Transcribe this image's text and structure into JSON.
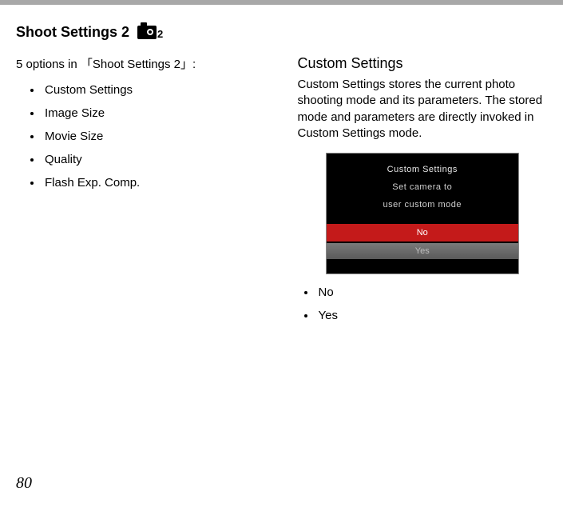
{
  "heading": "Shoot Settings 2",
  "heading_suffix": "2",
  "left": {
    "intro": "5 options in 「Shoot Settings 2」:",
    "items": [
      "Custom Settings",
      "Image Size",
      "Movie Size",
      "Quality",
      "Flash Exp. Comp."
    ]
  },
  "right": {
    "subheading": "Custom Settings",
    "paragraph": "Custom Settings stores the current photo shooting mode and its parameters. The stored mode and parameters are directly invoked in Custom Settings mode.",
    "screenshot": {
      "title": "Custom Settings",
      "line1": "Set camera  to",
      "line2": "user custom mode",
      "no": "No",
      "yes": "Yes"
    },
    "options": [
      "No",
      "Yes"
    ]
  },
  "page_number": "80"
}
